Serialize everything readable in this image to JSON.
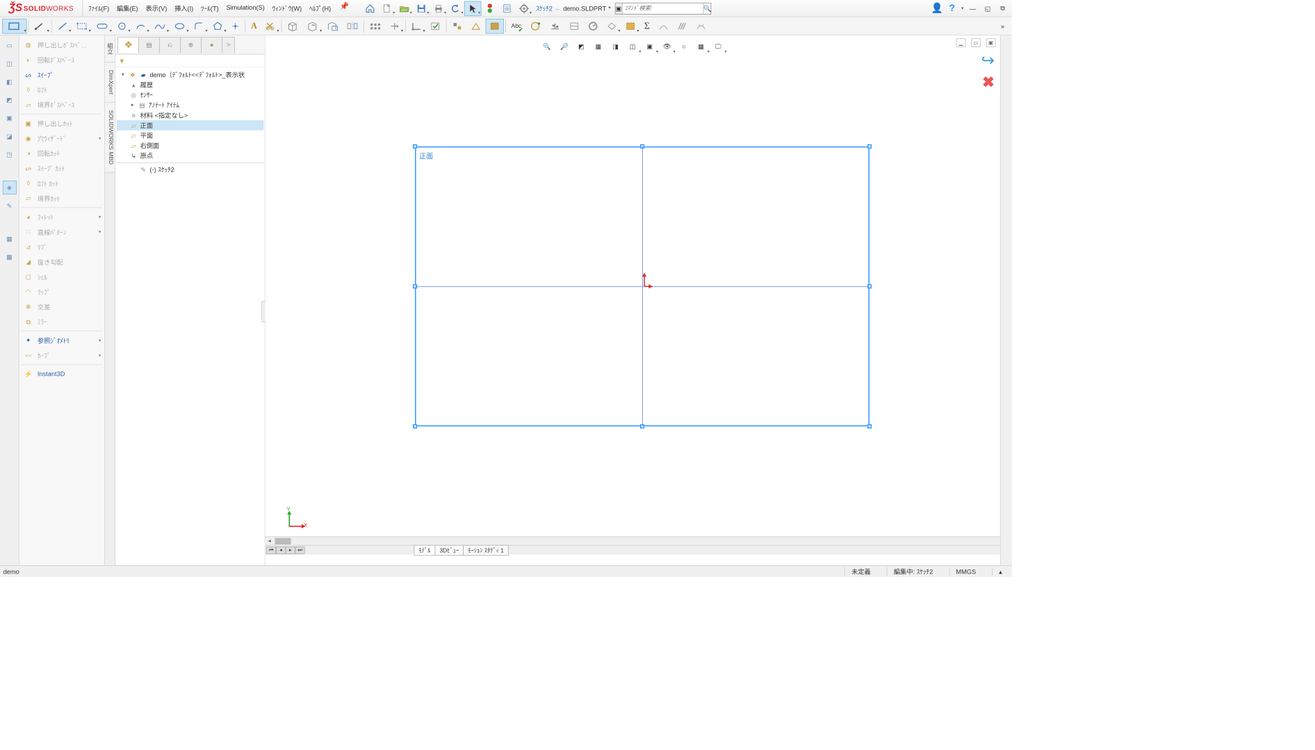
{
  "app": {
    "logo_solid": "SOLID",
    "logo_works": "WORKS"
  },
  "menu": {
    "file": "ﾌｧｲﾙ(F)",
    "edit": "編集(E)",
    "view": "表示(V)",
    "insert": "挿入(I)",
    "tools": "ﾂｰﾙ(T)",
    "simulation": "Simulation(S)",
    "window": "ｳｨﾝﾄﾞｳ(W)",
    "help": "ﾍﾙﾌﾟ(H)"
  },
  "breadcrumb": {
    "sketch": "ｽｹｯﾁ2",
    "arrow": "←",
    "doc": "demo.SLDPRT",
    "dirty": "*"
  },
  "search": {
    "placeholder": "ｺﾏﾝﾄﾞ検索"
  },
  "vtabs": {
    "sketch": "組立",
    "dimxpert": "DimXpert",
    "mbd": "SOLIDWORKS MBD"
  },
  "features": {
    "extrude": "押し出しﾎﾞｽ/ﾍﾞ…",
    "revolve": "回転ﾎﾞｽ/ﾍﾞｰｽ",
    "sweep": "ｽｲｰﾌﾟ",
    "loft": "ﾛﾌﾄ",
    "boundary": "境界ﾎﾞｽ/ﾍﾞｰｽ",
    "cut_extrude": "押し出しｶｯﾄ",
    "hole": "穴ｳｨｻﾞｰﾄﾞ",
    "cut_revolve": "回転ｶｯﾄ",
    "cut_sweep": "ｽｲｰﾌﾟ ｶｯﾄ",
    "cut_loft": "ﾛﾌﾄ ｶｯﾄ",
    "cut_boundary": "境界ｶｯﾄ",
    "fillet": "ﾌｨﾚｯﾄ",
    "pattern": "直線ﾊﾟﾀｰﾝ",
    "rib": "ﾘﾌﾞ",
    "draft": "抜き勾配",
    "shell": "ｼｪﾙ",
    "wrap": "ﾗｯﾌﾟ",
    "intersect": "交差",
    "mirror": "ﾐﾗｰ",
    "refgeo": "参照ｼﾞｵﾒﾄﾘ",
    "curves": "ｶｰﾌﾞ",
    "instant3d": "Instant3D"
  },
  "tree": {
    "root": "demo（ﾃﾞﾌｫﾙﾄ<<ﾃﾞﾌｫﾙﾄ>_表示状",
    "history": "履歴",
    "sensors": "ｾﾝｻｰ",
    "annotations": "ｱﾉﾃｰﾄ ｱｲﾃﾑ",
    "material": "材料 <指定なし>",
    "front": "正面",
    "top": "平面",
    "right": "右側面",
    "origin": "原点",
    "sketch": "(-) ｽｹｯﾁ2"
  },
  "viewport": {
    "plane_label": "正面",
    "caption_prefix": "*",
    "caption": "正面",
    "triad_x": "X",
    "triad_y": "Y"
  },
  "viewtabs": {
    "model": "ﾓﾃﾞﾙ",
    "view3d": "3Dﾋﾞｭｰ",
    "motion": "ﾓｰｼｮﾝ ｽﾀﾃﾞｨ 1"
  },
  "status": {
    "doc": "demo",
    "undef": "未定義",
    "editing": "編集中: ｽｹｯﾁ2",
    "units": "MMGS",
    "extra": "▴"
  }
}
